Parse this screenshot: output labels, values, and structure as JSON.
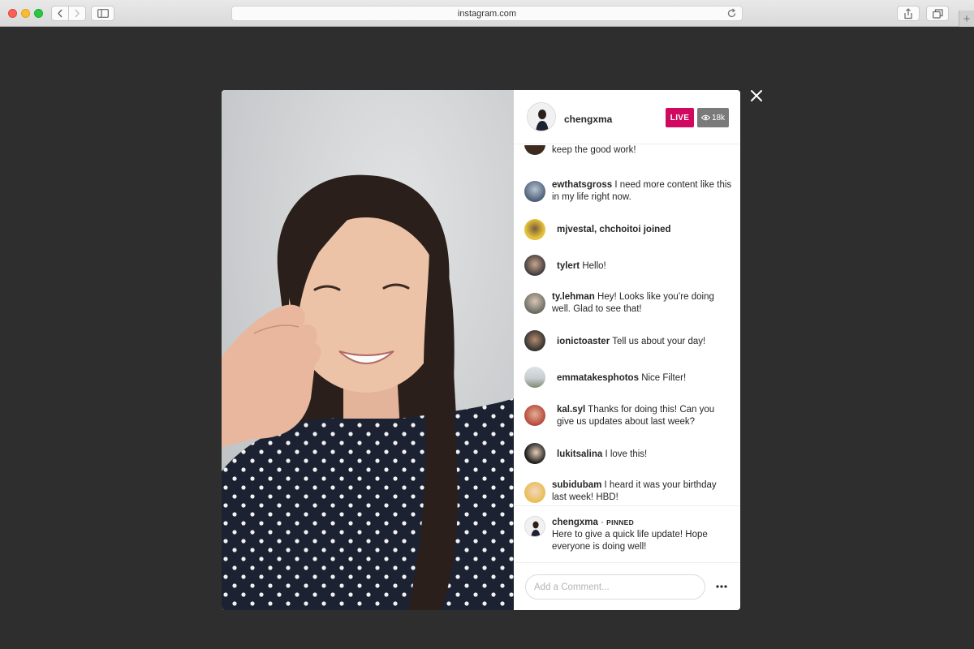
{
  "browser": {
    "url": "instagram.com",
    "icons": {
      "back": "chevron-left-icon",
      "forward": "chevron-right-icon",
      "sidebar": "sidebar-icon",
      "reload": "reload-icon",
      "share": "share-icon",
      "tabs": "tabs-icon",
      "new_tab": "plus-icon"
    },
    "new_tab_glyph": "+"
  },
  "live": {
    "host": "chengxma",
    "live_label": "LIVE",
    "viewer_count": "18k",
    "live_color": "#d1085f"
  },
  "comments": [
    {
      "user": "",
      "text": "keep the good work!"
    },
    {
      "user": "ewthatsgross",
      "text": "I need more content like this in my life right now."
    },
    {
      "user": "mjvestal, chchoitoi joined",
      "text": ""
    },
    {
      "user": "tylert",
      "text": "Hello!"
    },
    {
      "user": "ty.lehman",
      "text": "Hey! Looks like you’re doing well. Glad to see that!"
    },
    {
      "user": "ionictoaster",
      "text": "Tell us about your day!"
    },
    {
      "user": "emmatakesphotos",
      "text": "Nice Filter!"
    },
    {
      "user": "kal.syl",
      "text": "Thanks for doing this! Can you give us updates about last week?"
    },
    {
      "user": "lukitsalina",
      "text": "I love this!"
    },
    {
      "user": "subidubam",
      "text": "I heard it was your birthday last week! HBD!"
    }
  ],
  "pinned": {
    "user": "chengxma",
    "separator": "·",
    "label": "PINNED",
    "text": "Here to give a quick life update! Hope everyone is doing well!"
  },
  "composer": {
    "placeholder": "Add a Comment..."
  }
}
